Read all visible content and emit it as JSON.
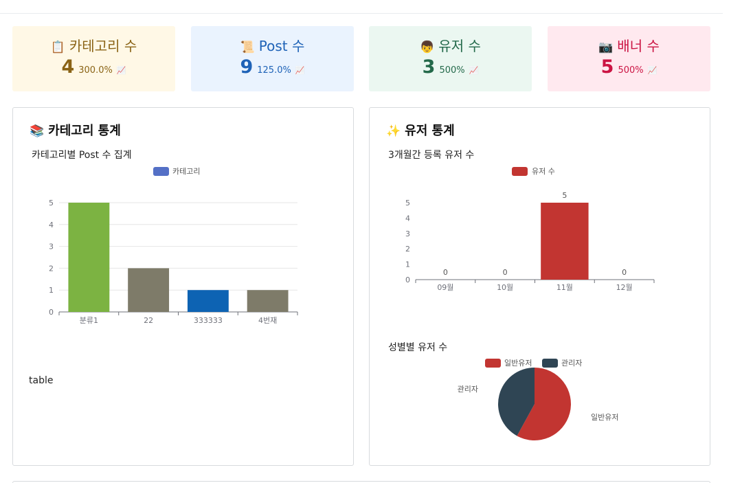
{
  "stat_cards": [
    {
      "emoji": "📋",
      "label": "카테고리 수",
      "value": "4",
      "percent": "300.0%",
      "trend": "📈"
    },
    {
      "emoji": "📜",
      "label": "Post 수",
      "value": "9",
      "percent": "125.0%",
      "trend": "📈"
    },
    {
      "emoji": "👦",
      "label": "유저 수",
      "value": "3",
      "percent": "500%",
      "trend": "📈"
    },
    {
      "emoji": "📷",
      "label": "배너 수",
      "value": "5",
      "percent": "500%",
      "trend": "📈"
    }
  ],
  "category_panel": {
    "emoji": "📚",
    "title": "카테고리 통계",
    "chart_subtitle": "카테고리별 Post 수 집계",
    "table_label": "table"
  },
  "user_panel": {
    "emoji": "✨",
    "title": "유저 통계",
    "monthly_subtitle": "3개월간 등록 유저 수",
    "gender_subtitle": "성별별 유저 수"
  },
  "chart_data": [
    {
      "type": "bar",
      "categories": [
        "분류1",
        "22",
        "333333",
        "4번재"
      ],
      "series": [
        {
          "name": "카테고리",
          "values": [
            5,
            2,
            1,
            1
          ]
        }
      ],
      "bar_colors": [
        "#7cb342",
        "#7e7b69",
        "#0d63b3",
        "#7e7b69"
      ],
      "legend_color": "#5470c6",
      "ylim": [
        0,
        5
      ],
      "yticks": [
        "0",
        "1",
        "2",
        "3",
        "4",
        "5"
      ],
      "grid": true,
      "legend": "top-center"
    },
    {
      "type": "bar",
      "categories": [
        "09월",
        "10월",
        "11월",
        "12월"
      ],
      "series": [
        {
          "name": "유저 수",
          "values": [
            0,
            0,
            5,
            0
          ]
        }
      ],
      "color": "#c23531",
      "ylim": [
        0,
        5
      ],
      "yticks": [
        "0",
        "1",
        "2",
        "3",
        "4",
        "5"
      ],
      "data_labels": true,
      "grid": false,
      "legend": "top-center"
    },
    {
      "type": "pie",
      "labels": [
        "일반유저",
        "관리자"
      ],
      "values": [
        58,
        42
      ],
      "colors": [
        "#c23531",
        "#2f4554"
      ],
      "legend": "top-center"
    }
  ]
}
